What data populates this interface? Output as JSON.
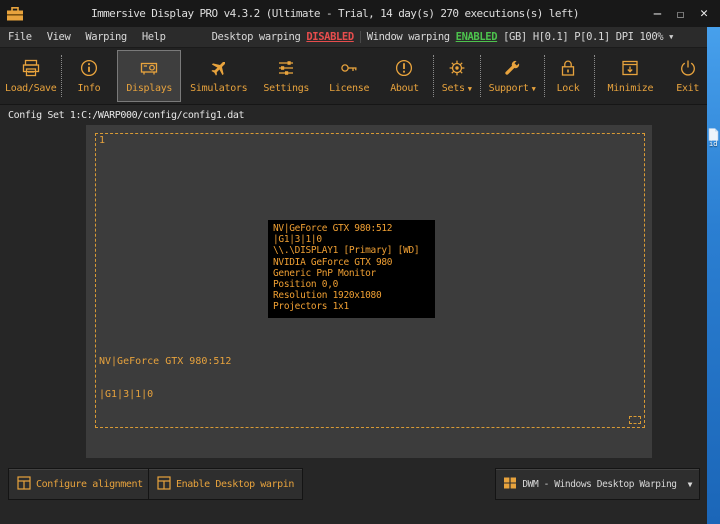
{
  "titlebar": {
    "title": "Immersive Display PRO v4.3.2 (Ultimate - Trial, 14 day(s) 270 executions(s) left)"
  },
  "menubar": {
    "items": [
      "File",
      "View",
      "Warping",
      "Help"
    ],
    "desktop_warping": {
      "label": "Desktop warping",
      "status": "DISABLED"
    },
    "window_warping": {
      "label": "Window warping",
      "status": "ENABLED"
    },
    "gb": "[GB]",
    "heading_pitch": "H[0.1] P[0.1]",
    "dpi": "DPI 100%"
  },
  "toolbar": {
    "buttons": [
      "Load/Save",
      "Info",
      "Displays",
      "Simulators",
      "Settings",
      "License",
      "About",
      "Sets",
      "Support",
      "Lock",
      "Minimize",
      "Exit"
    ],
    "active_button": "Displays"
  },
  "config_line": "Config Set 1:C:/WARP000/config/config1.dat",
  "display_area": {
    "display_number": "1",
    "info_tooltip": [
      "NV|GeForce GTX 980:512",
      "|G1|3|1|0",
      "\\\\.\\DISPLAY1 [Primary] [WD]",
      "NVIDIA GeForce GTX 980",
      "Generic PnP Monitor",
      "Position 0,0",
      "Resolution 1920x1080",
      "Projectors 1x1"
    ],
    "gpu_label": [
      "NV|GeForce GTX 980:512",
      "|G1|3|1|0"
    ]
  },
  "bottombar": {
    "configure_alignment": "Configure alignment",
    "enable_desktop_warping": "Enable Desktop warpin",
    "warping_mode": "DWM - Windows Desktop Warping"
  },
  "desktop": {
    "icon_label": "id"
  },
  "colors": {
    "accent": "#e8a33d",
    "disabled_red": "#e84d4d",
    "enabled_green": "#4dc24d",
    "desktop_blue": "#2b7fd2"
  }
}
